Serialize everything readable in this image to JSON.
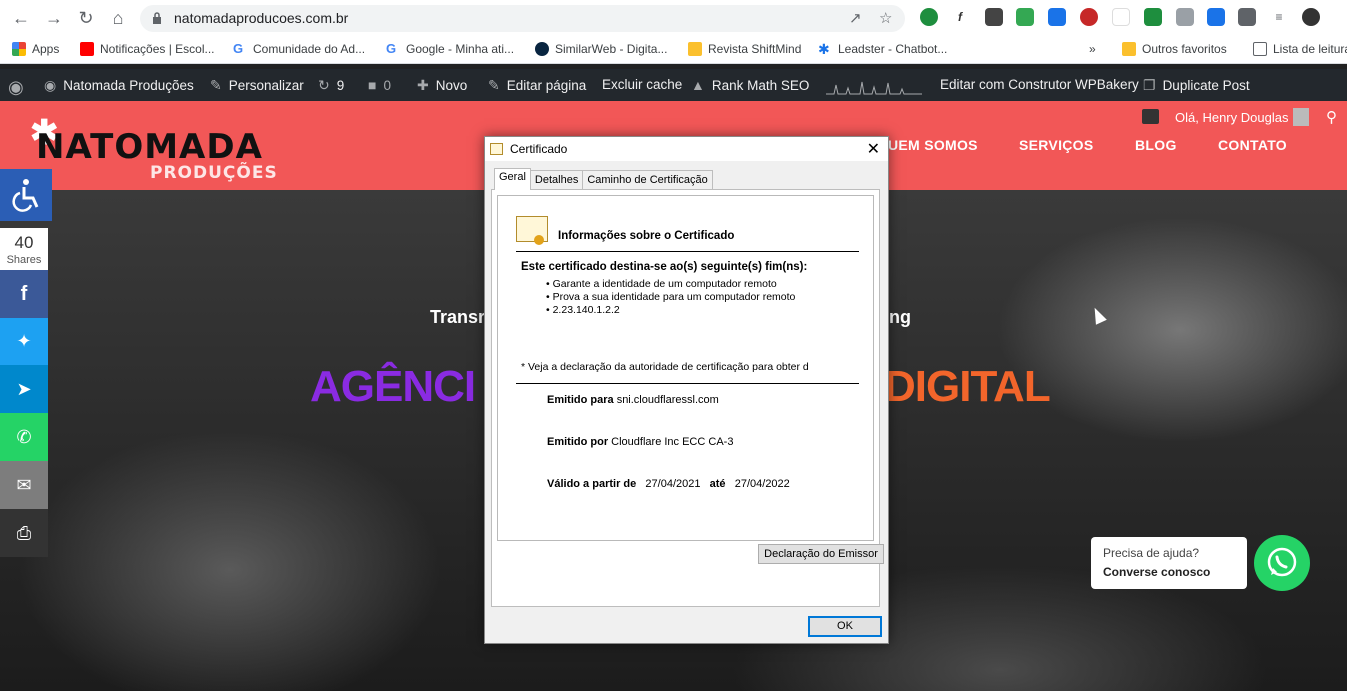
{
  "browser": {
    "url": "natomadaproducoes.com.br",
    "bookmarks": [
      {
        "label": "Apps"
      },
      {
        "label": "Notificações | Escol..."
      },
      {
        "label": "Comunidade do Ad..."
      },
      {
        "label": "Google - Minha ati..."
      },
      {
        "label": "SimilarWeb - Digita..."
      },
      {
        "label": "Revista ShiftMind"
      },
      {
        "label": "Leadster - Chatbot..."
      },
      {
        "label": "Outros favoritos"
      },
      {
        "label": "Lista de leitura"
      }
    ],
    "overflow": "»"
  },
  "adminbar": {
    "site": "Natomada Produções",
    "customize": "Personalizar",
    "updates": "9",
    "comments": "0",
    "new": "Novo",
    "edit": "Editar página",
    "cache": "Excluir cache",
    "rankmath": "Rank Math SEO",
    "wpbakery": "Editar com Construtor WPBakery",
    "duplicate": "Duplicate Post"
  },
  "header": {
    "logo_main": "NATOMADA",
    "logo_sub": "PRODUÇÕES",
    "menu": [
      "UEM SOMOS",
      "SERVIÇOS",
      "BLOG",
      "CONTATO"
    ],
    "greeting": "Olá, Henry Douglas"
  },
  "hero": {
    "small_left": "Transr",
    "small_right": "ting",
    "big_left": "AGÊNCI",
    "big_right": "DIGITAL"
  },
  "share": {
    "count": "40",
    "count_label": "Shares"
  },
  "whatsapp": {
    "line1": "Precisa de ajuda?",
    "line2": "Converse conosco"
  },
  "dialog": {
    "title": "Certificado",
    "tabs": [
      "Geral",
      "Detalhes",
      "Caminho de Certificação"
    ],
    "heading": "Informações sobre o Certificado",
    "purpose": "Este certificado destina-se ao(s) seguinte(s) fim(ns):",
    "bullets": [
      "Garante a identidade de um computador remoto",
      "Prova a sua identidade para um computador remoto",
      "2.23.140.1.2.2"
    ],
    "note": "* Veja a declaração da autoridade de certificação para obter d",
    "issued_to_label": "Emitido para",
    "issued_to": "sni.cloudflaressl.com",
    "issued_by_label": "Emitido por",
    "issued_by": "Cloudflare Inc ECC CA-3",
    "valid_from_label": "Válido a partir de",
    "valid_from": "27/04/2021",
    "valid_until_label": "até",
    "valid_until": "27/04/2022",
    "issuer_button": "Declaração do Emissor",
    "ok_button": "OK"
  }
}
